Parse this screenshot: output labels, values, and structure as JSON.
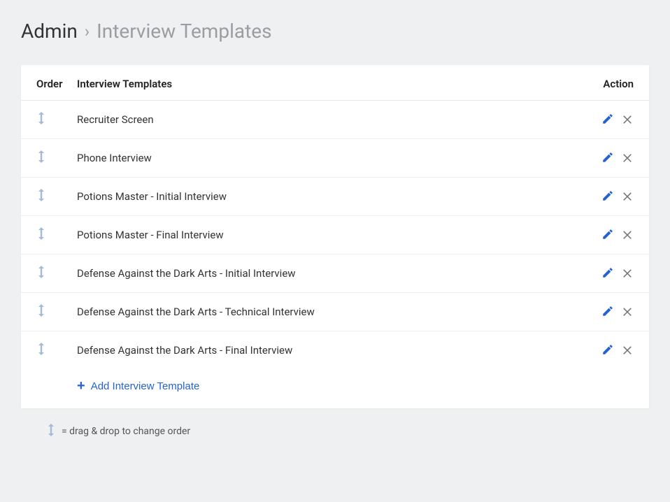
{
  "breadcrumb": {
    "root": "Admin",
    "current": "Interview Templates"
  },
  "table": {
    "headers": {
      "order": "Order",
      "name": "Interview Templates",
      "action": "Action"
    },
    "rows": [
      {
        "name": "Recruiter Screen"
      },
      {
        "name": "Phone Interview"
      },
      {
        "name": "Potions Master - Initial Interview"
      },
      {
        "name": "Potions Master - Final Interview"
      },
      {
        "name": "Defense Against the Dark Arts - Initial Interview"
      },
      {
        "name": "Defense Against the Dark Arts - Technical Interview"
      },
      {
        "name": "Defense Against the Dark Arts - Final Interview"
      }
    ],
    "add_label": "Add Interview Template"
  },
  "legend": {
    "text": "= drag & drop to change order"
  }
}
